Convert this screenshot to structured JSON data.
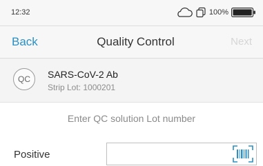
{
  "status_bar": {
    "time": "12:32",
    "battery_percent": "100%",
    "icons": [
      "cloud-icon",
      "copy-icon",
      "battery-icon"
    ]
  },
  "nav": {
    "back_label": "Back",
    "title": "Quality Control",
    "next_label": "Next"
  },
  "test": {
    "badge": "QC",
    "name": "SARS-CoV-2 Ab",
    "strip_lot": "Strip Lot: 1000201"
  },
  "instruction": "Enter QC solution Lot number",
  "fields": [
    {
      "label": "Positive",
      "value": "",
      "scan_icon": "barcode-scan-icon"
    }
  ],
  "colors": {
    "accent": "#2a8fc4",
    "disabled": "#d6d6d6",
    "scan_icon": "#2a8fc4"
  }
}
